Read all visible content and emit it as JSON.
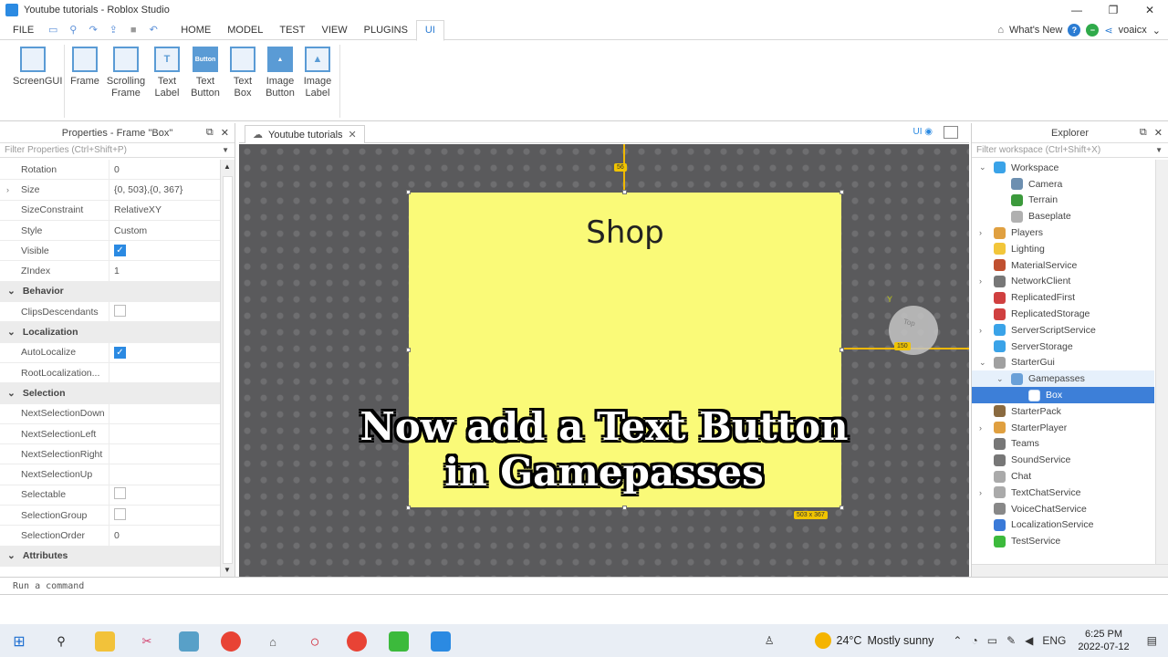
{
  "window": {
    "title": "Youtube tutorials - Roblox Studio",
    "controls": [
      "—",
      "❐",
      "✕"
    ]
  },
  "menubar": {
    "file": "FILE",
    "tabs": [
      "HOME",
      "MODEL",
      "TEST",
      "VIEW",
      "PLUGINS",
      "UI"
    ],
    "active_tab": "UI",
    "whats_new": "What's New",
    "user": "voaicx"
  },
  "ribbon": {
    "items": [
      {
        "label_1": "ScreenGUI",
        "label_2": "",
        "glyph": ""
      },
      {
        "label_1": "Frame",
        "label_2": "",
        "glyph": ""
      },
      {
        "label_1": "Scrolling",
        "label_2": "Frame",
        "glyph": ""
      },
      {
        "label_1": "Text",
        "label_2": "Label",
        "glyph": "T"
      },
      {
        "label_1": "Text",
        "label_2": "Button",
        "glyph": "Button"
      },
      {
        "label_1": "Text",
        "label_2": "Box",
        "glyph": ""
      },
      {
        "label_1": "Image",
        "label_2": "Button",
        "glyph": "▲"
      },
      {
        "label_1": "Image",
        "label_2": "Label",
        "glyph": "▲"
      }
    ]
  },
  "properties": {
    "title": "Properties - Frame \"Box\"",
    "filter_placeholder": "Filter Properties (Ctrl+Shift+P)",
    "rows": [
      {
        "name": "Rotation",
        "value": "0"
      },
      {
        "name": "Size",
        "value": "{0, 503},{0, 367}",
        "expandable": true
      },
      {
        "name": "SizeConstraint",
        "value": "RelativeXY"
      },
      {
        "name": "Style",
        "value": "Custom"
      },
      {
        "name": "Visible",
        "checkbox": true,
        "checked": true
      },
      {
        "name": "ZIndex",
        "value": "1"
      },
      {
        "section": "Behavior"
      },
      {
        "name": "ClipsDescendants",
        "checkbox": true,
        "checked": false
      },
      {
        "section": "Localization"
      },
      {
        "name": "AutoLocalize",
        "checkbox": true,
        "checked": true
      },
      {
        "name": "RootLocalization...",
        "value": ""
      },
      {
        "section": "Selection"
      },
      {
        "name": "NextSelectionDown",
        "value": ""
      },
      {
        "name": "NextSelectionLeft",
        "value": ""
      },
      {
        "name": "NextSelectionRight",
        "value": ""
      },
      {
        "name": "NextSelectionUp",
        "value": ""
      },
      {
        "name": "Selectable",
        "checkbox": true,
        "checked": false
      },
      {
        "name": "SelectionGroup",
        "checkbox": true,
        "checked": false
      },
      {
        "name": "SelectionOrder",
        "value": "0"
      },
      {
        "section": "Attributes"
      }
    ]
  },
  "viewport": {
    "tab_label": "Youtube tutorials",
    "ui_toggle": "UI",
    "frame_text": "Shop",
    "dim_top": "56",
    "dim_right": "150",
    "dim_size": "503 x 367",
    "gizmo_axis": "Y",
    "gizmo_label": "Top",
    "caption_line1": "Now add a Text Button",
    "caption_line2": "in Gamepasses"
  },
  "explorer": {
    "title": "Explorer",
    "filter_placeholder": "Filter workspace (Ctrl+Shift+X)",
    "items": [
      {
        "label": "Workspace",
        "depth": 0,
        "arrow": "open",
        "color": "#3aa3e8"
      },
      {
        "label": "Camera",
        "depth": 1,
        "arrow": "",
        "color": "#6d8fb0"
      },
      {
        "label": "Terrain",
        "depth": 1,
        "arrow": "",
        "color": "#3c9a3c"
      },
      {
        "label": "Baseplate",
        "depth": 1,
        "arrow": "",
        "color": "#b0b0b0"
      },
      {
        "label": "Players",
        "depth": 0,
        "arrow": "closed",
        "color": "#e0a040"
      },
      {
        "label": "Lighting",
        "depth": 0,
        "arrow": "",
        "color": "#f2c63a"
      },
      {
        "label": "MaterialService",
        "depth": 0,
        "arrow": "",
        "color": "#c05030"
      },
      {
        "label": "NetworkClient",
        "depth": 0,
        "arrow": "closed",
        "color": "#777777"
      },
      {
        "label": "ReplicatedFirst",
        "depth": 0,
        "arrow": "",
        "color": "#d04040"
      },
      {
        "label": "ReplicatedStorage",
        "depth": 0,
        "arrow": "",
        "color": "#d04040"
      },
      {
        "label": "ServerScriptService",
        "depth": 0,
        "arrow": "closed",
        "color": "#3aa3e8"
      },
      {
        "label": "ServerStorage",
        "depth": 0,
        "arrow": "",
        "color": "#3aa3e8"
      },
      {
        "label": "StarterGui",
        "depth": 0,
        "arrow": "open",
        "color": "#a0a0a0"
      },
      {
        "label": "Gamepasses",
        "depth": 1,
        "arrow": "open",
        "color": "#6aa0d8",
        "state": "hover"
      },
      {
        "label": "Box",
        "depth": 2,
        "arrow": "",
        "color": "#ffffff",
        "state": "selected"
      },
      {
        "label": "StarterPack",
        "depth": 0,
        "arrow": "",
        "color": "#8a6a40"
      },
      {
        "label": "StarterPlayer",
        "depth": 0,
        "arrow": "closed",
        "color": "#e0a040"
      },
      {
        "label": "Teams",
        "depth": 0,
        "arrow": "",
        "color": "#777777"
      },
      {
        "label": "SoundService",
        "depth": 0,
        "arrow": "",
        "color": "#777777"
      },
      {
        "label": "Chat",
        "depth": 0,
        "arrow": "",
        "color": "#aaaaaa"
      },
      {
        "label": "TextChatService",
        "depth": 0,
        "arrow": "closed",
        "color": "#aaaaaa"
      },
      {
        "label": "VoiceChatService",
        "depth": 0,
        "arrow": "",
        "color": "#888888"
      },
      {
        "label": "LocalizationService",
        "depth": 0,
        "arrow": "",
        "color": "#3a7ad8"
      },
      {
        "label": "TestService",
        "depth": 0,
        "arrow": "",
        "color": "#3cba3c"
      }
    ]
  },
  "command_bar": {
    "placeholder": "Run a command"
  },
  "taskbar": {
    "weather_temp": "24°C",
    "weather_text": "Mostly sunny",
    "language": "ENG",
    "time": "6:25 PM",
    "date": "2022-07-12"
  }
}
